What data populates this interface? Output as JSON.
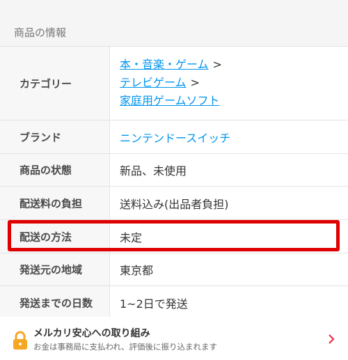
{
  "section": {
    "title": "商品の情報"
  },
  "rows": [
    {
      "label": "カテゴリー",
      "categories": [
        {
          "text": "本・音楽・ゲーム",
          "sep": ">"
        },
        {
          "text": "テレビゲーム",
          "sep": ">"
        },
        {
          "text": "家庭用ゲームソフト",
          "sep": ""
        }
      ]
    },
    {
      "label": "ブランド",
      "value": "ニンテンドースイッチ"
    },
    {
      "label": "商品の状態",
      "value": "新品、未使用"
    },
    {
      "label": "配送料の負担",
      "value": "送料込み(出品者負担)"
    },
    {
      "label": "配送の方法",
      "value": "未定"
    },
    {
      "label": "発送元の地域",
      "value": "東京都"
    },
    {
      "label": "発送までの日数",
      "value": "1~2日で発送"
    }
  ],
  "anshin": {
    "title": "メルカリ安心への取り組み",
    "subtitle": "お金は事務局に支払われ、評価後に振り込まれます",
    "icon": "lock-icon",
    "arrow_icon": "chevron-right-icon"
  },
  "colors": {
    "link": "#0095ee",
    "highlight": "#e00000",
    "lock": "#f5a623",
    "chevron": "#e8334a"
  }
}
